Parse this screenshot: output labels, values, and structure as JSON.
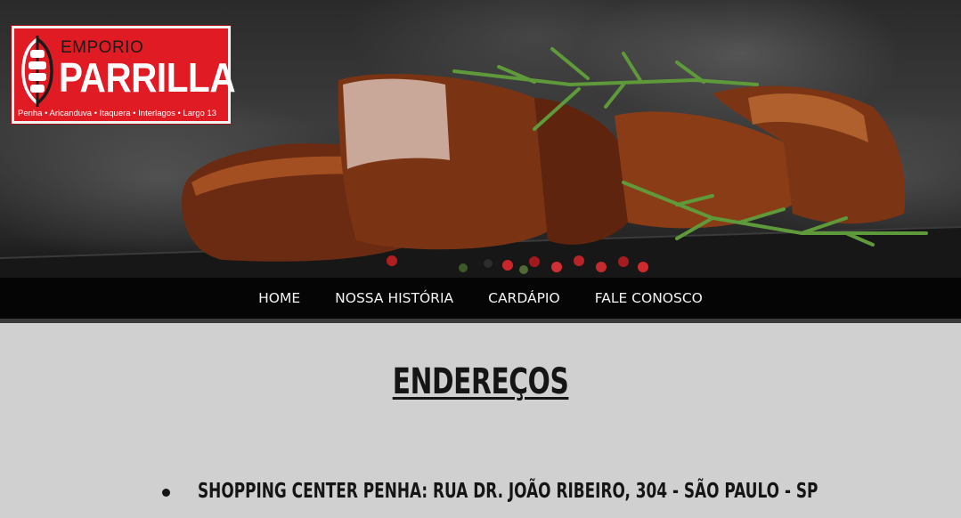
{
  "logo": {
    "emporio": "EMPORIO",
    "parrilla": "PARRILLA",
    "locations": "Penha • Aricanduva • Itaquera • Interlagos • Largo 13",
    "brand_color": "#e01b24"
  },
  "hero": {
    "image": "grilled-meat-with-rosemary-and-peppercorns"
  },
  "nav": {
    "items": [
      {
        "label": "HOME"
      },
      {
        "label": "NOSSA HISTÓRIA"
      },
      {
        "label": "CARDÁPIO"
      },
      {
        "label": "FALE CONOSCO"
      }
    ],
    "background": "#050505",
    "text_color": "#f2f2f2"
  },
  "main": {
    "title": "ENDEREÇOS",
    "addresses": [
      "SHOPPING CENTER PENHA: RUA DR. JOÃO RIBEIRO, 304 - SÃO PAULO - SP"
    ],
    "background": "#d0d0d0"
  }
}
